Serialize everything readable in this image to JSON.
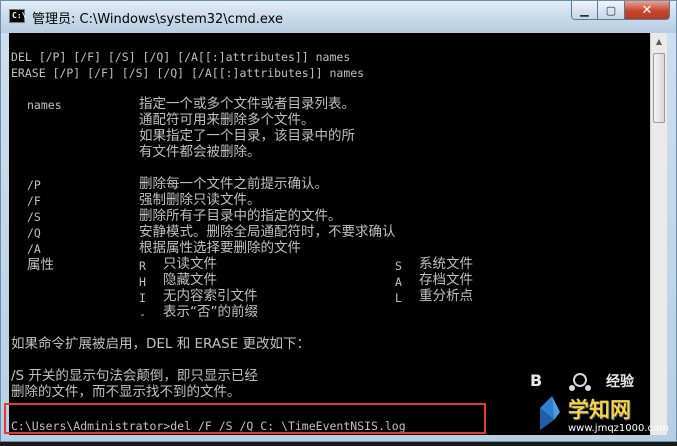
{
  "window": {
    "title": "管理员: C:\\Windows\\system32\\cmd.exe",
    "buttons": {
      "minimize": "▁",
      "restore": "▢",
      "close": "✕"
    }
  },
  "console": {
    "syntax": [
      "DEL [/P] [/F] [/S] [/Q] [/A[[:]attributes]] names",
      "ERASE [/P] [/F] [/S] [/Q] [/A[[:]attributes]] names"
    ],
    "names_param": "names",
    "names_desc": [
      "指定一个或多个文件或者目录列表。",
      "通配符可用来删除多个文件。",
      "如果指定了一个目录，该目录中的所",
      "有文件都会被删除。"
    ],
    "options": [
      {
        "flag": "/P",
        "desc": "删除每一个文件之前提示确认。"
      },
      {
        "flag": "/F",
        "desc": "强制删除只读文件。"
      },
      {
        "flag": "/S",
        "desc": "删除所有子目录中的指定的文件。"
      },
      {
        "flag": "/Q",
        "desc": "安静模式。删除全局通配符时，不要求确认"
      },
      {
        "flag": "/A",
        "desc": "根据属性选择要删除的文件"
      }
    ],
    "attr_label": "属性",
    "attributes": [
      {
        "code": "R",
        "desc": "只读文件",
        "code2": "S",
        "desc2": "系统文件"
      },
      {
        "code": "H",
        "desc": "隐藏文件",
        "code2": "A",
        "desc2": "存档文件"
      },
      {
        "code": "I",
        "desc": "无内容索引文件",
        "code2": "L",
        "desc2": "重分析点"
      },
      {
        "code": "-",
        "desc": "表示“否”的前缀",
        "code2": "",
        "desc2": ""
      }
    ],
    "ext_note": "如果命令扩展被启用，DEL 和 ERASE 更改如下：",
    "s_note": [
      "/S 开关的显示句法会颠倒，即只显示已经",
      "删除的文件，而不显示找不到的文件。"
    ],
    "prompt": "C:\\Users\\Administrator>",
    "command": "del /F /S /Q C: \\TimeEventNSIS.log"
  },
  "watermark": {
    "brand_left": "B",
    "brand_right": "经验",
    "site_name": "学知网",
    "site_url": "www.jmqz1000.com"
  }
}
